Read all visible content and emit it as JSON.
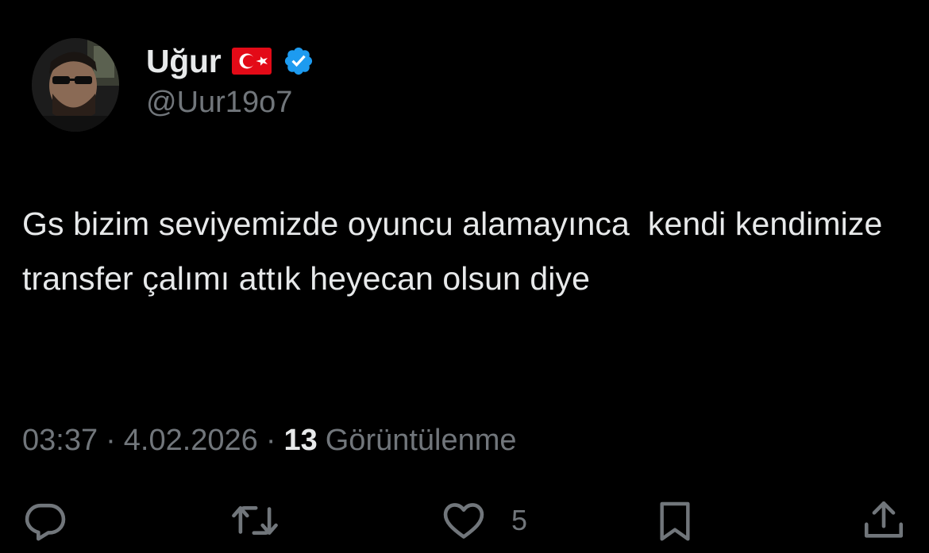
{
  "author": {
    "display_name": "Uğur",
    "handle": "@Uur19o7",
    "flag_icon": "turkey-flag-icon",
    "verified_icon": "verified-badge-icon",
    "verified_color": "#1d9bf0",
    "flag_color": "#e30a17"
  },
  "tweet": {
    "text": "Gs bizim seviyemizde oyuncu alamayınca  kendi kendimize transfer çalımı attık heyecan olsun diye",
    "time": "03:37",
    "separator": "·",
    "date": "4.02.2026",
    "views_count": "13",
    "views_label": "Görüntülenme"
  },
  "actions": {
    "reply_icon": "reply-icon",
    "retweet_icon": "retweet-icon",
    "like_icon": "heart-icon",
    "like_count": "5",
    "bookmark_icon": "bookmark-icon",
    "share_icon": "share-icon"
  },
  "colors": {
    "background": "#000000",
    "text_primary": "#e7e9ea",
    "text_secondary": "#71767b"
  }
}
